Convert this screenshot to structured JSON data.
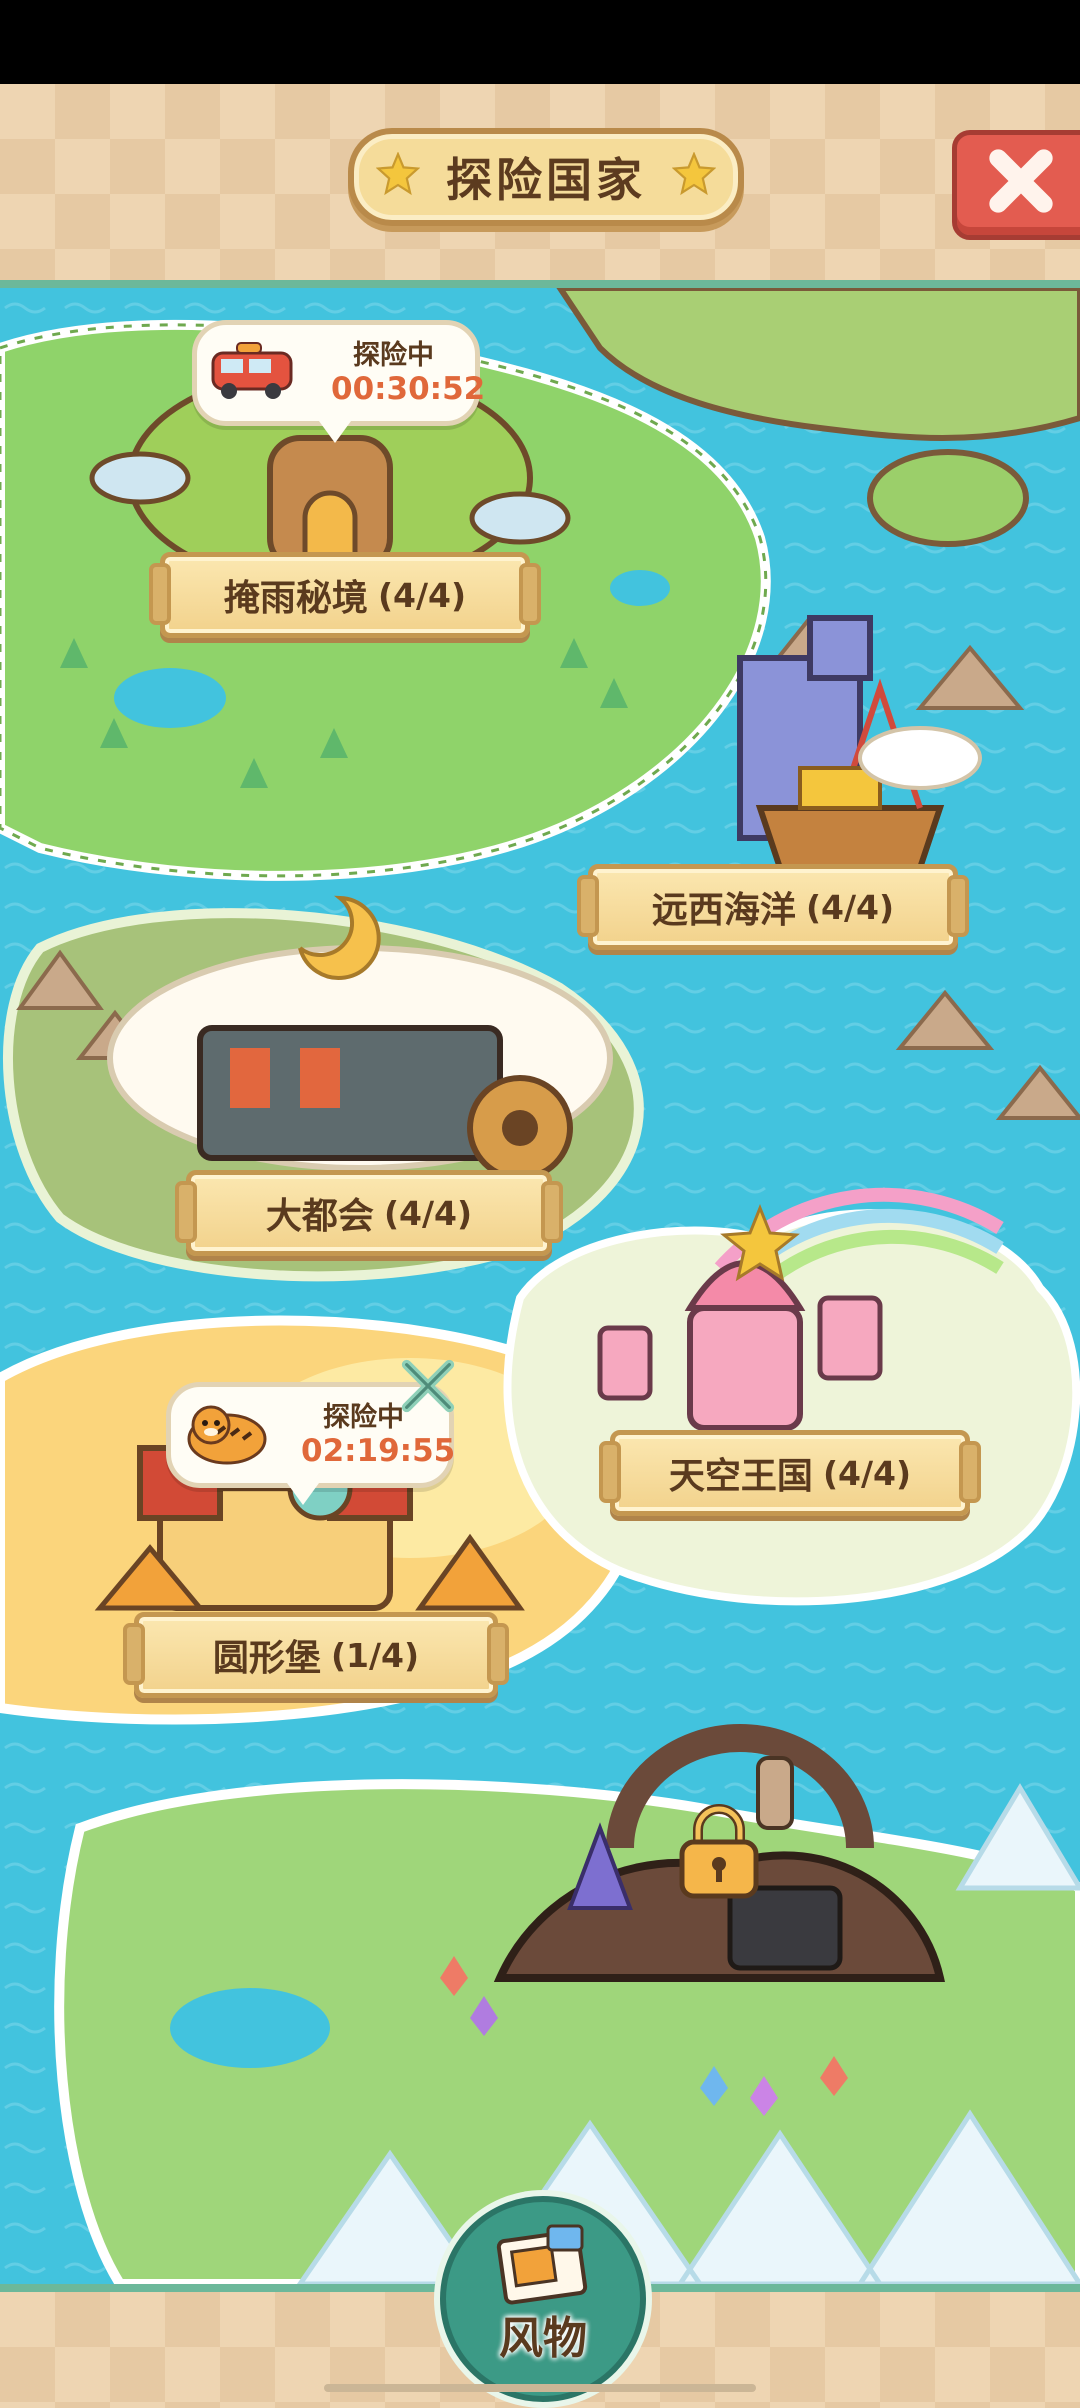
{
  "header": {
    "title": "探险国家"
  },
  "regions": [
    {
      "name": "掩雨秘境",
      "progress": "(4/4)",
      "expedition": {
        "status": "探险中",
        "timer": "00:30:52",
        "avatar": "red-bus"
      }
    },
    {
      "name": "远西海洋",
      "progress": "(4/4)"
    },
    {
      "name": "大都会",
      "progress": "(4/4)"
    },
    {
      "name": "天空王国",
      "progress": "(4/4)"
    },
    {
      "name": "圆形堡",
      "progress": "(1/4)",
      "expedition": {
        "status": "探险中",
        "timer": "02:19:55",
        "avatar": "tiger"
      }
    }
  ],
  "locked_region": {
    "icon": "padlock-icon"
  },
  "footer": {
    "souvenir_label": "风物"
  },
  "colors": {
    "sea": "#42c3de",
    "grass": "#8fd36a",
    "banner": "#f2d28c",
    "timer": "#e0683a",
    "header": "#eed5b2"
  }
}
